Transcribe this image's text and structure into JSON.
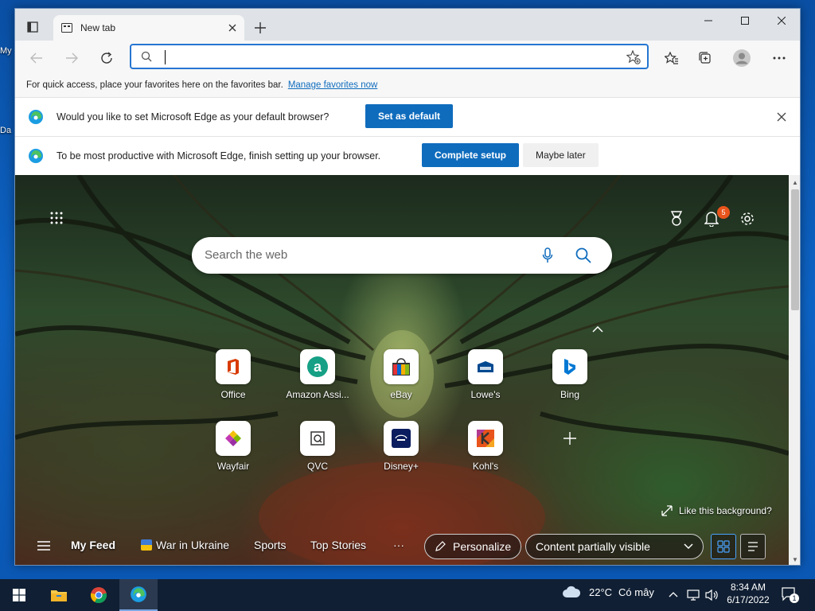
{
  "desktop": {
    "icon1_label": "My",
    "icon2_label": "Da"
  },
  "browser": {
    "tab_title": "New tab",
    "window_controls": [
      "minimize-icon",
      "maximize-icon",
      "close-icon"
    ],
    "address_value": "",
    "favorites_bar_text": "For quick access, place your favorites here on the favorites bar.",
    "favorites_bar_link": "Manage favorites now",
    "default_prompt": {
      "message": "Would you like to set Microsoft Edge as your default browser?",
      "button": "Set as default"
    },
    "setup_prompt": {
      "message": "To be most productive with Microsoft Edge, finish setting up your browser.",
      "primary_button": "Complete setup",
      "secondary_button": "Maybe later"
    }
  },
  "newtab": {
    "search_placeholder": "Search the web",
    "notification_count": "5",
    "quick_links": [
      {
        "label": "Office",
        "icon": "office-icon",
        "color": "#d83b01"
      },
      {
        "label": "Amazon Assi...",
        "icon": "amazon-icon",
        "color": "#16a085"
      },
      {
        "label": "eBay",
        "icon": "ebay-icon",
        "color": "#e53238"
      },
      {
        "label": "Lowe's",
        "icon": "lowes-icon",
        "color": "#004990"
      },
      {
        "label": "Bing",
        "icon": "bing-icon",
        "color": "#0078d4"
      },
      {
        "label": "Wayfair",
        "icon": "wayfair-icon",
        "color": "#7b189f"
      },
      {
        "label": "QVC",
        "icon": "qvc-icon",
        "color": "#333333"
      },
      {
        "label": "Disney+",
        "icon": "disney-icon",
        "color": "#0b1d5e"
      },
      {
        "label": "Kohl's",
        "icon": "kohls-icon",
        "color": "#d83b01"
      }
    ],
    "like_background": "Like this background?",
    "feed": {
      "my_feed": "My Feed",
      "war_in_ukraine": "War in Ukraine",
      "sports": "Sports",
      "top_stories": "Top Stories",
      "more": "···",
      "personalize": "Personalize",
      "content_visibility": "Content partially visible"
    }
  },
  "taskbar": {
    "weather_temp": "22°C",
    "weather_desc": "Có mây",
    "time": "8:34 AM",
    "date": "6/17/2022",
    "notification_badge": "1"
  }
}
